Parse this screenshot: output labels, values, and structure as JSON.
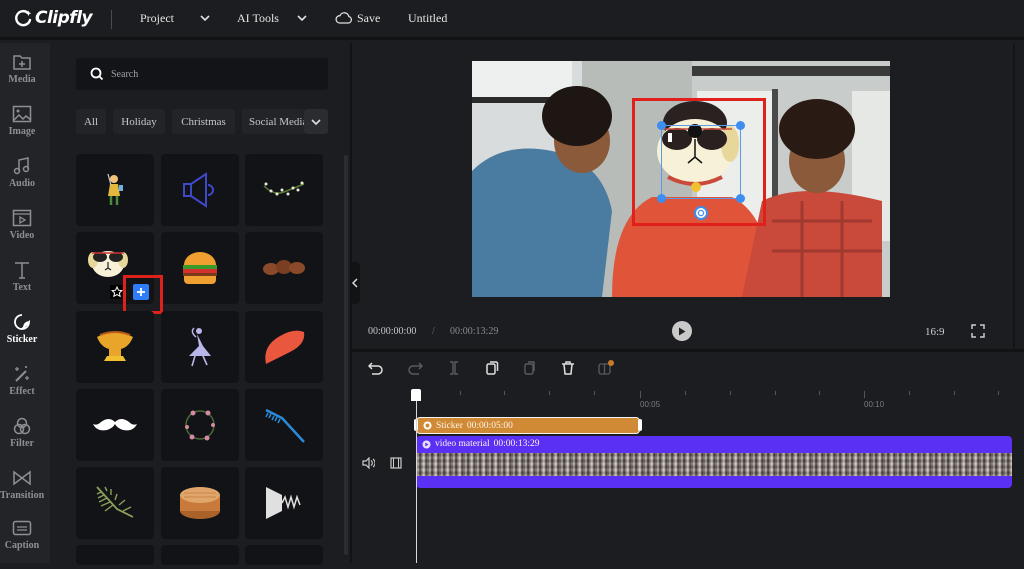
{
  "app": {
    "name": "Clipfly",
    "menu": {
      "project": "Project",
      "ai_tools": "AI Tools",
      "save": "Save",
      "document_title": "Untitled"
    }
  },
  "sidebar": {
    "items": [
      {
        "label": "Media",
        "icon": "folder-plus-icon"
      },
      {
        "label": "Image",
        "icon": "image-icon"
      },
      {
        "label": "Audio",
        "icon": "music-note-icon"
      },
      {
        "label": "Video",
        "icon": "video-icon"
      },
      {
        "label": "Text",
        "icon": "text-icon"
      },
      {
        "label": "Sticker",
        "icon": "sticker-icon",
        "active": true
      },
      {
        "label": "Effect",
        "icon": "magic-wand-icon"
      },
      {
        "label": "Filter",
        "icon": "filter-circles-icon"
      },
      {
        "label": "Transition",
        "icon": "transition-bowtie-icon"
      },
      {
        "label": "Caption",
        "icon": "caption-icon"
      }
    ]
  },
  "panel": {
    "search": {
      "placeholder": "Search"
    },
    "categories": [
      "All",
      "Holiday",
      "Christmas",
      "Social Media"
    ],
    "stickers": [
      "Woman with selfie stick",
      "Speaker volume",
      "Floral vine",
      "Dog with sunglasses",
      "Burger",
      "Coffee beans",
      "Golden tree bowl",
      "Dancer",
      "Red feather",
      "Mustache",
      "Flower wreath",
      "Blue comb",
      "Fern leaf",
      "Wooden box",
      "Spring shock"
    ],
    "hover_actions": {
      "favorite": "star-icon",
      "add": "plus-icon"
    }
  },
  "preview": {
    "current_time": "00:00:00:00",
    "separator": "/",
    "total_time": "00:00:13:29",
    "aspect_ratio": "16:9"
  },
  "timeline": {
    "toolbar": [
      "undo-icon",
      "redo-icon",
      "split-icon",
      "duplicate-icon",
      "copy-icon",
      "delete-icon",
      "replace-icon"
    ],
    "ruler_labels": [
      "00:05",
      "00:10"
    ],
    "tracks": {
      "sticker": {
        "label": "Sticker",
        "duration": "00:00:05:00",
        "color": "#d08a36"
      },
      "video": {
        "label": "video material",
        "duration": "00:00:13:29",
        "color": "#5a31f4"
      }
    }
  },
  "colors": {
    "accent": "#2f7cf6",
    "highlight": "#e0201b"
  }
}
